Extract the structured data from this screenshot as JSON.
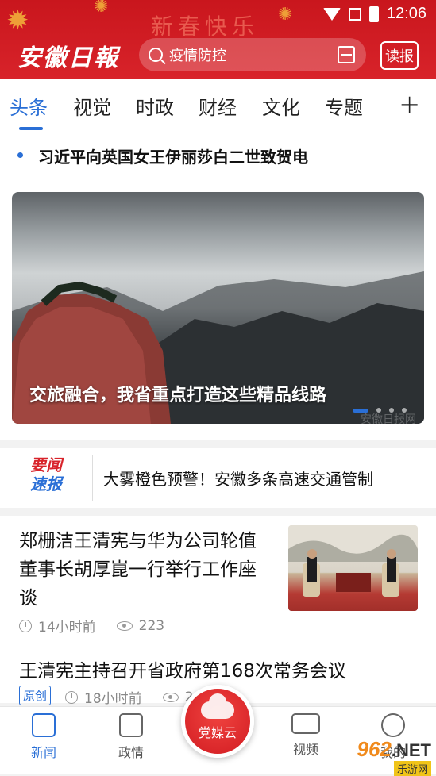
{
  "status_bar": {
    "time": "12:06"
  },
  "header": {
    "festive_text": "新春快乐",
    "logo": "安徽日報",
    "search_placeholder": "疫情防控",
    "read_label": "读报"
  },
  "tabs": [
    "头条",
    "视觉",
    "时政",
    "财经",
    "文化",
    "专题"
  ],
  "active_tab": "头条",
  "top_headline": "习近平向英国女王伊丽莎白二世致贺电",
  "hero": {
    "title": "交旅融合，我省重点打造这些精品线路",
    "watermark": "安徽日报网",
    "slides": 4,
    "active_slide": 1
  },
  "flash": {
    "logo_line1": "要闻",
    "logo_line2": "速报",
    "text": "大雾橙色预警！安徽多条高速交通管制"
  },
  "feed": [
    {
      "title": "郑栅洁王清宪与华为公司轮值董事长胡厚崑一行举行工作座谈",
      "time": "14小时前",
      "views": "223"
    },
    {
      "title": "王清宪主持召开省政府第168次常务会议",
      "tag": "原创",
      "time": "18小时前",
      "views": "26"
    }
  ],
  "bottom_nav": {
    "items": [
      "新闻",
      "政情",
      "党媒云",
      "视频",
      "我的"
    ],
    "active": "新闻"
  },
  "watermark_badge": {
    "num": "962",
    "net": ".NET",
    "sub": "乐游网"
  },
  "colors": {
    "brand_red": "#d8232a",
    "accent_blue": "#2a6fd6"
  }
}
